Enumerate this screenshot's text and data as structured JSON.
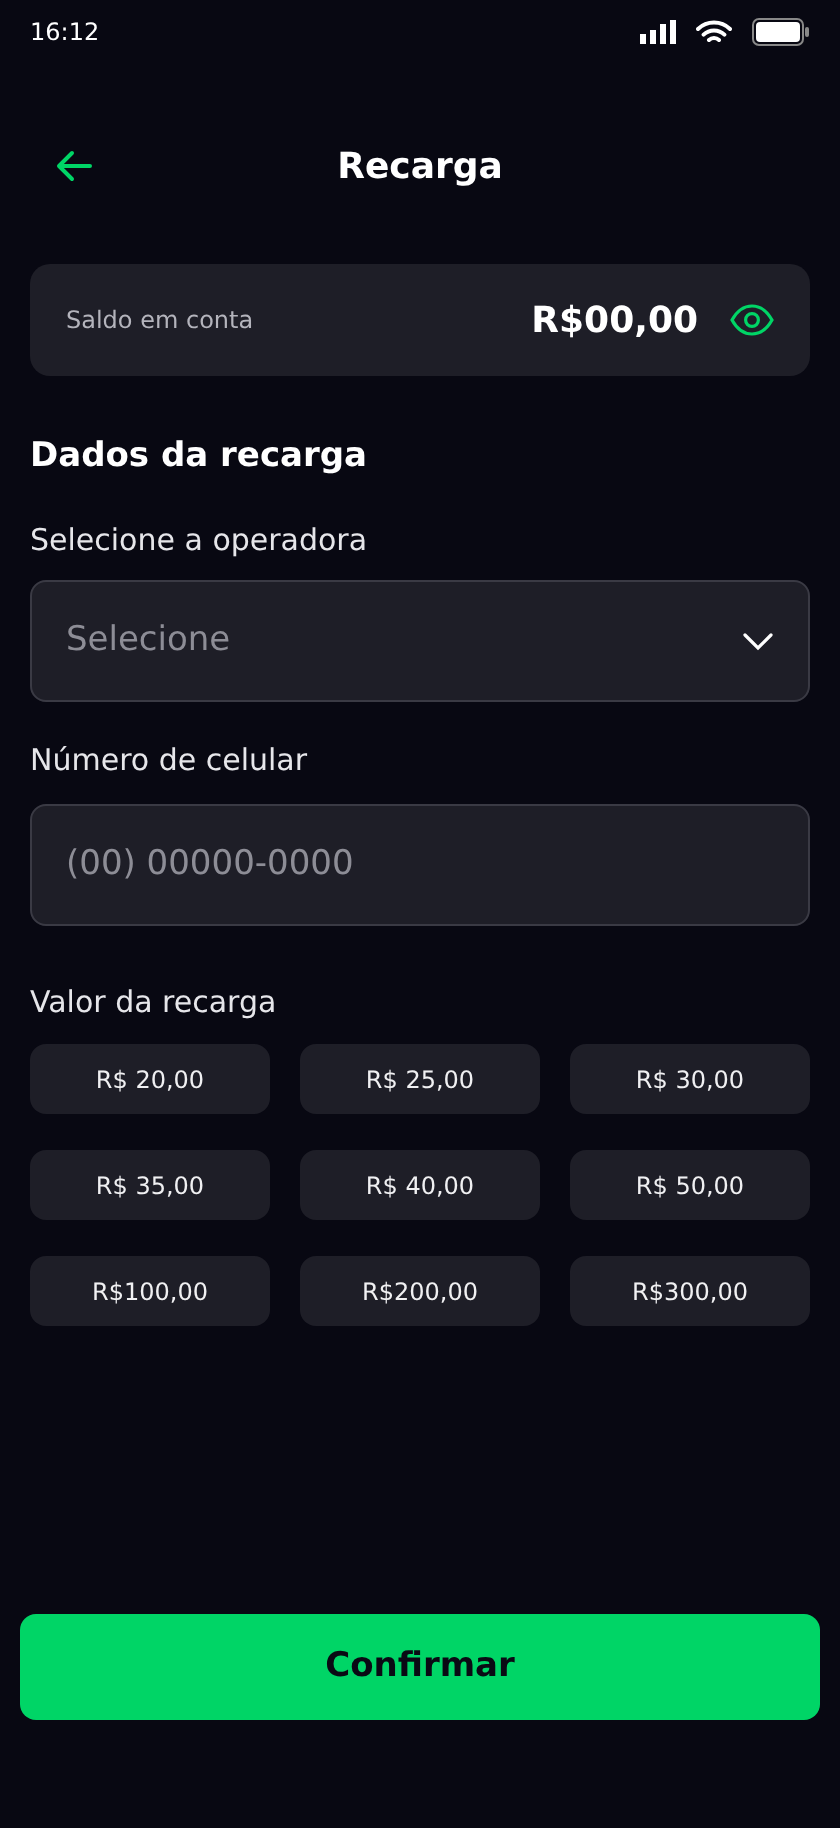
{
  "status_bar": {
    "time": "16:12"
  },
  "header": {
    "title": "Recarga"
  },
  "balance": {
    "label": "Saldo em conta",
    "value": "R$00,00"
  },
  "section_title": "Dados da recarga",
  "operator": {
    "label": "Selecione a operadora",
    "placeholder": "Selecione"
  },
  "phone": {
    "label": "Número de celular",
    "placeholder": "(00) 00000-0000"
  },
  "amounts": {
    "label": "Valor da recarga",
    "options": [
      "R$ 20,00",
      "R$ 25,00",
      "R$ 30,00",
      "R$ 35,00",
      "R$ 40,00",
      "R$ 50,00",
      "R$100,00",
      "R$200,00",
      "R$300,00"
    ]
  },
  "confirm_button": "Confirmar"
}
